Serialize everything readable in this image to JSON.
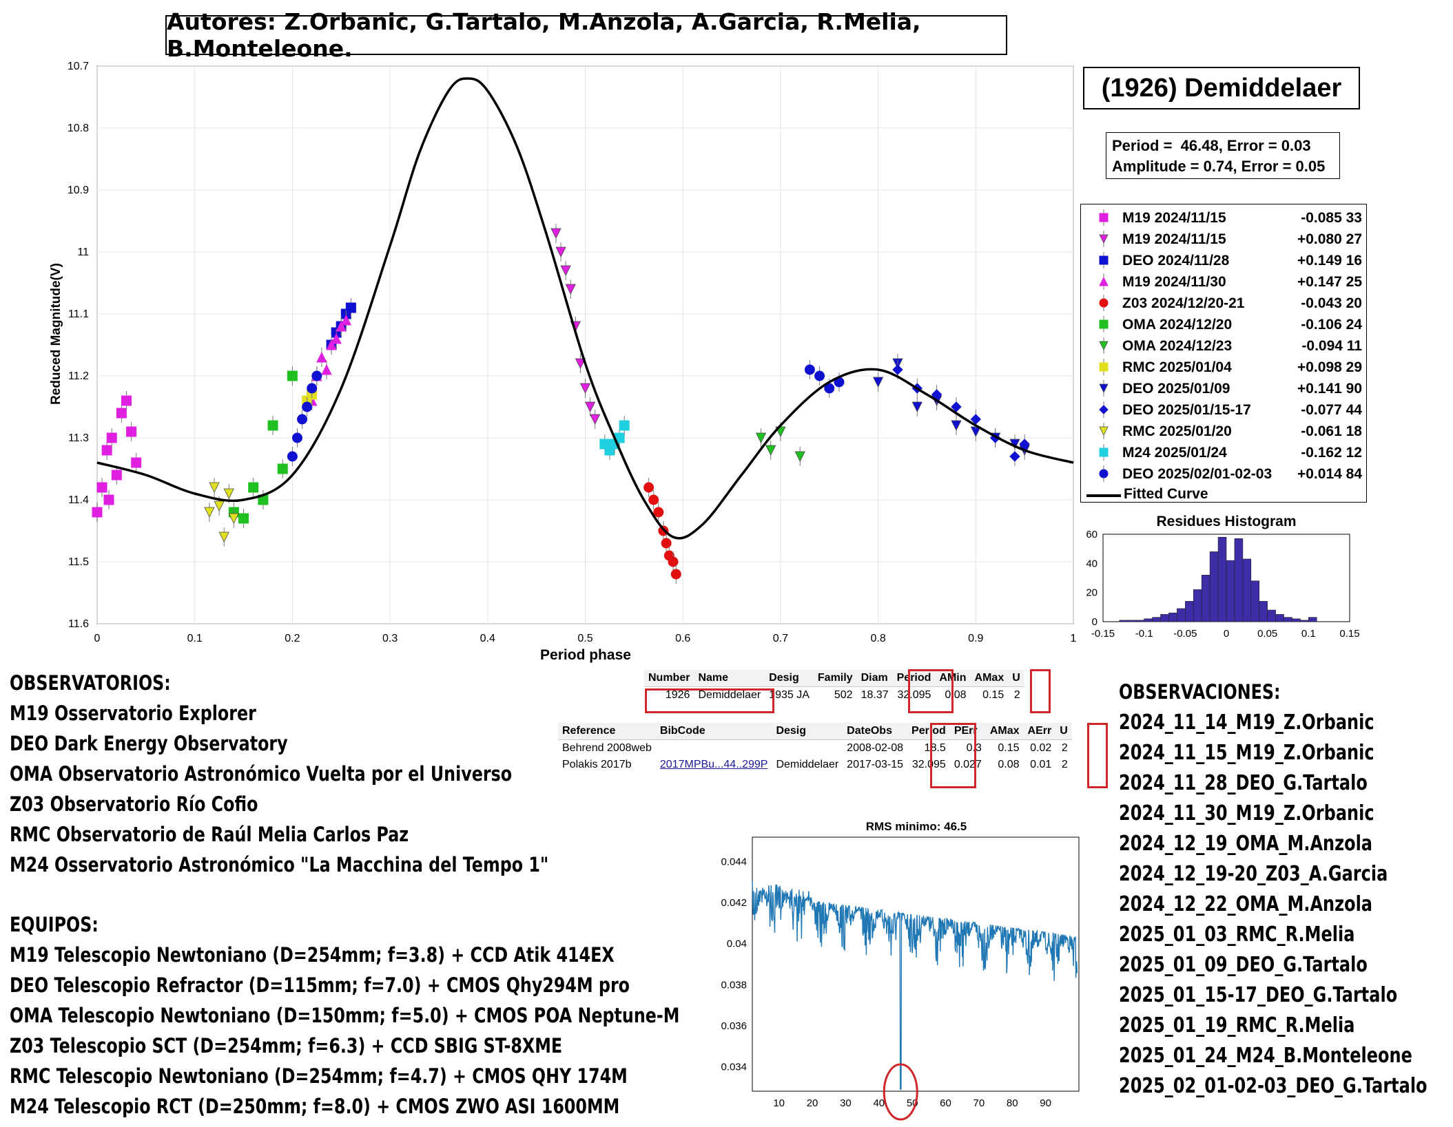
{
  "authors": "Autores: Z.Orbanic, G.Tartalo, M.Anzola, A.Garcia, R.Melia, B.Monteleone.",
  "object_title": "(1926) Demiddelaer",
  "fit": {
    "period_line": "Period =  46.48, Error = 0.03",
    "amplitude_line": "Amplitude = 0.74, Error = 0.05"
  },
  "colors": {
    "fit_curve": "#000000",
    "histogram_bar": "#3d2ea8",
    "periodogram_line": "#1f77b4",
    "highlight_red": "#d0262b"
  },
  "chart_data": [
    {
      "type": "scatter",
      "xlabel": "Period phase",
      "ylabel": "Reduced Magnitude(V)",
      "xlim": [
        0,
        1
      ],
      "ylim": [
        10.7,
        11.6
      ],
      "y_reversed": true,
      "grid": true,
      "legend_position": "right",
      "x_ticks": [
        "0",
        "0.1",
        "0.2",
        "0.3",
        "0.4",
        "0.5",
        "0.6",
        "0.7",
        "0.8",
        "0.9",
        "1"
      ],
      "y_ticks": [
        "10.7",
        "10.8",
        "10.9",
        "11",
        "11.1",
        "11.2",
        "11.3",
        "11.4",
        "11.5",
        "11.6"
      ],
      "fitted_curve": {
        "name": "Fitted Curve",
        "x": [
          0,
          0.05,
          0.1,
          0.15,
          0.2,
          0.25,
          0.3,
          0.33,
          0.36,
          0.38,
          0.4,
          0.43,
          0.46,
          0.5,
          0.53,
          0.56,
          0.59,
          0.62,
          0.66,
          0.7,
          0.75,
          0.8,
          0.85,
          0.9,
          0.95,
          1.0
        ],
        "y": [
          11.34,
          11.36,
          11.39,
          11.4,
          11.36,
          11.22,
          10.99,
          10.84,
          10.74,
          10.72,
          10.74,
          10.83,
          10.97,
          11.18,
          11.3,
          11.4,
          11.46,
          11.44,
          11.36,
          11.28,
          11.21,
          11.19,
          11.23,
          11.28,
          11.32,
          11.34
        ]
      },
      "series": [
        {
          "name": "M19 2024/11/15",
          "offset": "-0.085 33",
          "marker": "square",
          "color": "#e020e0",
          "x": [
            0.0,
            0.005,
            0.01,
            0.012,
            0.015,
            0.02,
            0.025,
            0.03,
            0.035,
            0.04
          ],
          "y": [
            11.42,
            11.38,
            11.32,
            11.4,
            11.3,
            11.36,
            11.26,
            11.24,
            11.29,
            11.34
          ]
        },
        {
          "name": "M19 2024/11/15",
          "offset": "+0.080 27",
          "marker": "triangle-down",
          "color": "#e020e0",
          "x": [
            0.47,
            0.475,
            0.48,
            0.485,
            0.49,
            0.495,
            0.5,
            0.505,
            0.51
          ],
          "y": [
            10.97,
            11.0,
            11.03,
            11.06,
            11.12,
            11.18,
            11.22,
            11.25,
            11.27
          ]
        },
        {
          "name": "DEO 2024/11/28",
          "offset": "+0.149 16",
          "marker": "square",
          "color": "#1010d0",
          "x": [
            0.24,
            0.245,
            0.25,
            0.255,
            0.26
          ],
          "y": [
            11.15,
            11.13,
            11.12,
            11.1,
            11.09
          ]
        },
        {
          "name": "M19 2024/11/30",
          "offset": "+0.147 25",
          "marker": "triangle-up",
          "color": "#e020e0",
          "x": [
            0.22,
            0.225,
            0.23,
            0.235,
            0.24,
            0.245,
            0.25,
            0.255
          ],
          "y": [
            11.24,
            11.2,
            11.17,
            11.19,
            11.15,
            11.14,
            11.12,
            11.11
          ]
        },
        {
          "name": "Z03 2024/12/20-21",
          "offset": "-0.043 20",
          "marker": "circle",
          "color": "#e01010",
          "x": [
            0.565,
            0.57,
            0.575,
            0.58,
            0.583,
            0.586,
            0.59,
            0.593
          ],
          "y": [
            11.38,
            11.4,
            11.42,
            11.45,
            11.47,
            11.49,
            11.5,
            11.52
          ]
        },
        {
          "name": "OMA 2024/12/20",
          "offset": "-0.106 24",
          "marker": "square",
          "color": "#20c020",
          "x": [
            0.14,
            0.15,
            0.16,
            0.17,
            0.18,
            0.19,
            0.2
          ],
          "y": [
            11.42,
            11.43,
            11.38,
            11.4,
            11.28,
            11.35,
            11.2
          ]
        },
        {
          "name": "OMA 2024/12/23",
          "offset": "-0.094 11",
          "marker": "triangle-down",
          "color": "#20c020",
          "x": [
            0.68,
            0.69,
            0.7,
            0.72
          ],
          "y": [
            11.3,
            11.32,
            11.29,
            11.33
          ]
        },
        {
          "name": "RMC 2025/01/04",
          "offset": "+0.098 29",
          "marker": "square",
          "color": "#e0e020",
          "x": [
            0.215,
            0.22
          ],
          "y": [
            11.24,
            11.23
          ]
        },
        {
          "name": "DEO 2025/01/09",
          "offset": "+0.141 90",
          "marker": "triangle-down",
          "color": "#1010d0",
          "x": [
            0.8,
            0.82,
            0.84,
            0.86,
            0.88,
            0.9,
            0.92,
            0.94,
            0.95
          ],
          "y": [
            11.21,
            11.18,
            11.25,
            11.24,
            11.28,
            11.29,
            11.3,
            11.31,
            11.32
          ]
        },
        {
          "name": "DEO 2025/01/15-17",
          "offset": "-0.077 44",
          "marker": "diamond",
          "color": "#1010d0",
          "x": [
            0.82,
            0.84,
            0.86,
            0.88,
            0.9,
            0.92,
            0.94,
            0.95
          ],
          "y": [
            11.19,
            11.22,
            11.23,
            11.25,
            11.27,
            11.3,
            11.33,
            11.31
          ]
        },
        {
          "name": "RMC 2025/01/20",
          "offset": "-0.061 18",
          "marker": "triangle-down",
          "color": "#e0e020",
          "x": [
            0.115,
            0.12,
            0.125,
            0.13,
            0.135,
            0.14
          ],
          "y": [
            11.42,
            11.38,
            11.41,
            11.46,
            11.39,
            11.43
          ]
        },
        {
          "name": "M24 2025/01/24",
          "offset": "-0.162 12",
          "marker": "square",
          "color": "#20d0e0",
          "x": [
            0.52,
            0.525,
            0.53,
            0.535,
            0.54
          ],
          "y": [
            11.31,
            11.32,
            11.31,
            11.3,
            11.28
          ]
        },
        {
          "name": "DEO 2025/02/01-02-03",
          "offset": "+0.014 84",
          "marker": "circle",
          "color": "#1010d0",
          "x": [
            0.2,
            0.205,
            0.21,
            0.215,
            0.22,
            0.225,
            0.73,
            0.74,
            0.75,
            0.76
          ],
          "y": [
            11.33,
            11.3,
            11.27,
            11.25,
            11.22,
            11.2,
            11.19,
            11.2,
            11.22,
            11.21
          ]
        }
      ]
    },
    {
      "type": "bar",
      "title": "Residues Histogram",
      "xlim": [
        -0.15,
        0.15
      ],
      "ylim": [
        0,
        60
      ],
      "x_ticks": [
        "-0.15",
        "-0.1",
        "-0.05",
        "0",
        "0.05",
        "0.1",
        "0.15"
      ],
      "y_ticks": [
        "0",
        "20",
        "40",
        "60"
      ],
      "bin_centers": [
        -0.125,
        -0.115,
        -0.105,
        -0.095,
        -0.085,
        -0.075,
        -0.065,
        -0.055,
        -0.045,
        -0.035,
        -0.025,
        -0.015,
        -0.005,
        0.005,
        0.015,
        0.025,
        0.035,
        0.045,
        0.055,
        0.065,
        0.075,
        0.085,
        0.095,
        0.105
      ],
      "values": [
        1,
        1,
        1,
        2,
        3,
        5,
        6,
        9,
        14,
        22,
        32,
        48,
        58,
        42,
        57,
        43,
        28,
        14,
        8,
        5,
        3,
        2,
        1,
        3
      ]
    },
    {
      "type": "line",
      "title": "RMS minimo: 46.5",
      "xlim": [
        2,
        100
      ],
      "ylim": [
        0.0328,
        0.0452
      ],
      "x_ticks": [
        "10",
        "20",
        "30",
        "40",
        "50",
        "60",
        "70",
        "80",
        "90"
      ],
      "y_ticks": [
        "0.034",
        "0.036",
        "0.038",
        "0.04",
        "0.042",
        "0.044"
      ],
      "minimum": {
        "x": 46.5,
        "y": 0.0329
      }
    }
  ],
  "lcdb_table1": {
    "headers": [
      "Number",
      "Name",
      "Desig",
      "Family",
      "Diam",
      "Period",
      "AMin",
      "AMax",
      "U"
    ],
    "row": [
      "1926",
      "Demiddelaer",
      "1935 JA",
      "502",
      "18.37",
      "32.095",
      "0.08",
      "0.15",
      "2"
    ]
  },
  "lcdb_table2": {
    "headers": [
      "Reference",
      "BibCode",
      "Desig",
      "DateObs",
      "Period",
      "PErr",
      "AMax",
      "AErr",
      "U"
    ],
    "rows": [
      [
        "Behrend 2008web",
        "",
        "",
        "2008-02-08",
        "18.5",
        "0.3",
        "0.15",
        "0.02",
        "2"
      ],
      [
        "Polakis 2017b",
        "2017MPBu...44..299P",
        "Demiddelaer",
        "2017-03-15",
        "32.095",
        "0.027",
        "0.08",
        "0.01",
        "2"
      ]
    ]
  },
  "observatorios": {
    "heading": "OBSERVATORIOS:",
    "items": [
      "M19 Osservatorio Explorer",
      "DEO Dark Energy Observatory",
      "OMA Observatorio Astronómico Vuelta por el Universo",
      "Z03 Observatorio Río Cofio",
      "RMC Observatorio de Raúl Melia Carlos Paz",
      "M24 Osservatorio Astronómico \"La Macchina del Tempo 1\""
    ]
  },
  "equipos": {
    "heading": "EQUIPOS:",
    "items": [
      "M19 Telescopio Newtoniano (D=254mm; f=3.8) + CCD Atik 414EX",
      "DEO Telescopio Refractor (D=115mm; f=7.0) + CMOS Qhy294M pro",
      "OMA Telescopio Newtoniano (D=150mm; f=5.0) + CMOS POA Neptune-M",
      "Z03 Telescopio SCT (D=254mm; f=6.3) + CCD SBIG ST-8XME",
      "RMC Telescopio Newtoniano (D=254mm; f=4.7) + CMOS QHY 174M",
      "M24 Telescopio RCT (D=250mm; f=8.0) + CMOS ZWO ASI 1600MM"
    ]
  },
  "observaciones": {
    "heading": "OBSERVACIONES:",
    "items": [
      "2024_11_14_M19_Z.Orbanic",
      "2024_11_15_M19_Z.Orbanic",
      "2024_11_28_DEO_G.Tartalo",
      "2024_11_30_M19_Z.Orbanic",
      "2024_12_19_OMA_M.Anzola",
      "2024_12_19-20_Z03_A.Garcia",
      "2024_12_22_OMA_M.Anzola",
      "2025_01_03_RMC_R.Melia",
      "2025_01_09_DEO_G.Tartalo",
      "2025_01_15-17_DEO_G.Tartalo",
      "2025_01_19_RMC_R.Melia",
      "2025_01_24_M24_B.Monteleone",
      "2025_02_01-02-03_DEO_G.Tartalo"
    ]
  }
}
